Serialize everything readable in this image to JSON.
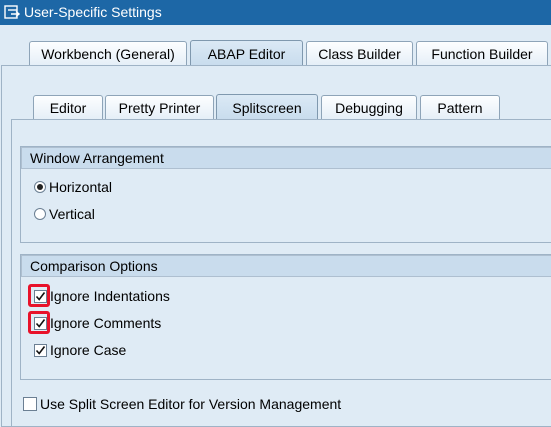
{
  "window": {
    "title": "User-Specific Settings"
  },
  "main_tabs": [
    {
      "label": "Workbench (General)",
      "active": false
    },
    {
      "label": "ABAP Editor",
      "active": true
    },
    {
      "label": "Class Builder",
      "active": false
    },
    {
      "label": "Function Builder",
      "active": false
    }
  ],
  "sub_tabs": [
    {
      "label": "Editor",
      "active": false
    },
    {
      "label": "Pretty Printer",
      "active": false
    },
    {
      "label": "Splitscreen",
      "active": true
    },
    {
      "label": "Debugging",
      "active": false
    },
    {
      "label": "Pattern",
      "active": false
    }
  ],
  "window_arrangement": {
    "title": "Window Arrangement",
    "options": [
      {
        "label": "Horizontal",
        "selected": true
      },
      {
        "label": "Vertical",
        "selected": false
      }
    ]
  },
  "comparison_options": {
    "title": "Comparison Options",
    "options": [
      {
        "label": "Ignore Indentations",
        "checked": true,
        "highlighted": true
      },
      {
        "label": "Ignore Comments",
        "checked": true,
        "highlighted": true
      },
      {
        "label": "Ignore Case",
        "checked": true,
        "highlighted": false
      }
    ]
  },
  "split_screen_version": {
    "label": "Use Split Screen Editor for Version Management",
    "checked": false
  },
  "colors": {
    "titlebar": "#1d67a6",
    "highlight": "#e8122a",
    "background": "#dfebf5"
  }
}
